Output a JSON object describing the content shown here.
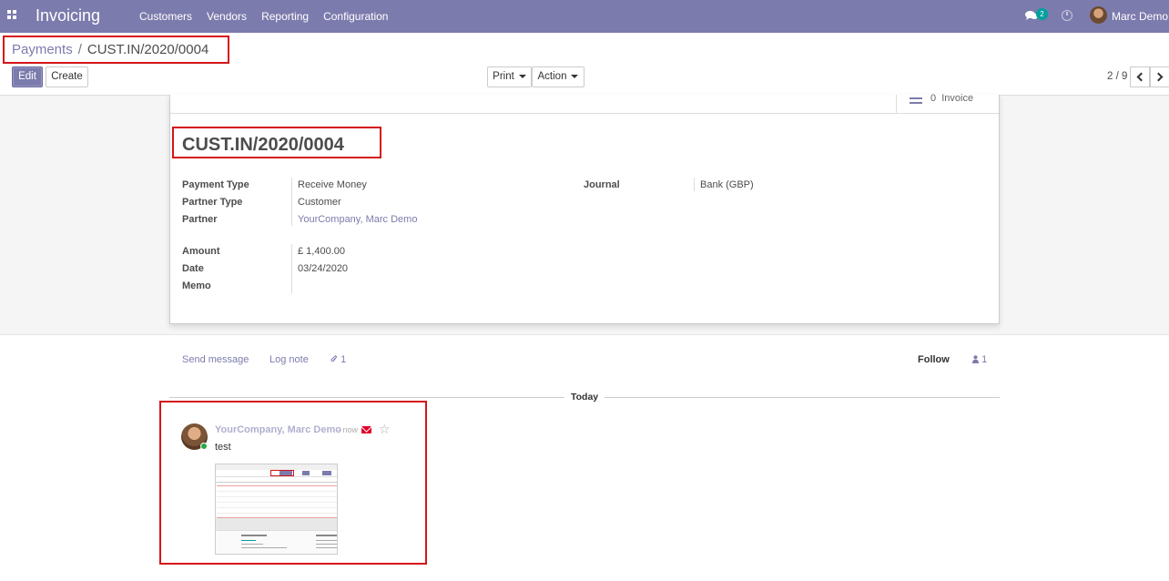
{
  "navbar": {
    "app_name": "Invoicing",
    "menu": [
      "Customers",
      "Vendors",
      "Reporting",
      "Configuration"
    ],
    "chat_badge": "2",
    "user_name": "Marc Demo"
  },
  "breadcrumb": {
    "parent": "Payments",
    "separator": "/",
    "current": "CUST.IN/2020/0004"
  },
  "toolbar": {
    "edit_label": "Edit",
    "create_label": "Create",
    "print_label": "Print",
    "action_label": "Action",
    "pager": "2 / 9"
  },
  "form": {
    "stat_button": {
      "count": "0",
      "label": "Invoice"
    },
    "title": "CUST.IN/2020/0004",
    "fields_left": [
      {
        "label": "Payment Type",
        "value": "Receive Money"
      },
      {
        "label": "Partner Type",
        "value": "Customer"
      },
      {
        "label": "Partner",
        "value": "YourCompany, Marc Demo"
      },
      {
        "label": "Amount",
        "value": "£ 1,400.00"
      },
      {
        "label": "Date",
        "value": "03/24/2020"
      },
      {
        "label": "Memo",
        "value": ""
      }
    ],
    "fields_right": [
      {
        "label": "Journal",
        "value": "Bank (GBP)"
      }
    ]
  },
  "chatter": {
    "send_message": "Send message",
    "log_note": "Log note",
    "attachments_count": "1",
    "follow": "Follow",
    "followers_count": "1",
    "date_separator": "Today",
    "message": {
      "author": "YourCompany, Marc Demo",
      "time": "- now",
      "body": "test"
    }
  },
  "colors": {
    "brand": "#7c7bad",
    "annotation_red": "#d4151a",
    "online": "#28a745",
    "badge": "#00a09d"
  }
}
